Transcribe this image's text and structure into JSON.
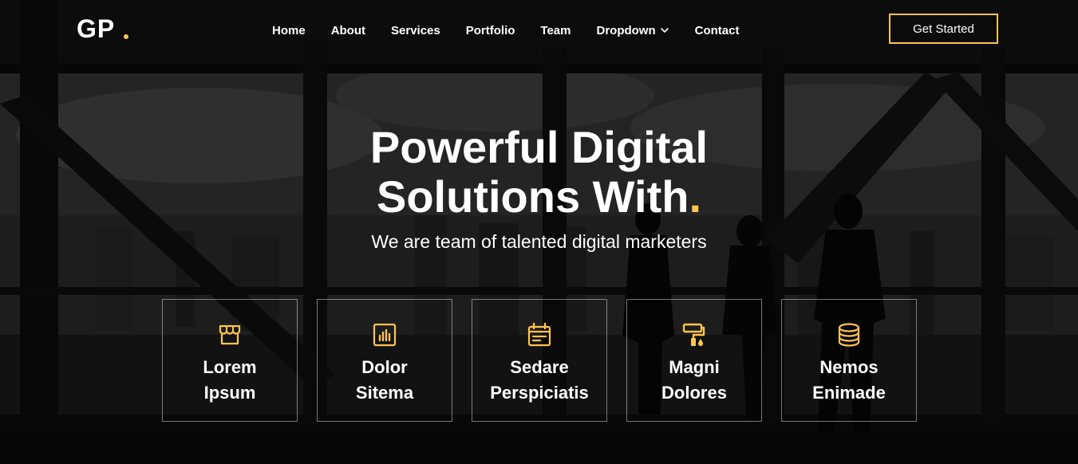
{
  "header": {
    "logo": "GP",
    "nav": [
      {
        "label": "Home"
      },
      {
        "label": "About"
      },
      {
        "label": "Services"
      },
      {
        "label": "Portfolio"
      },
      {
        "label": "Team"
      },
      {
        "label": "Dropdown"
      },
      {
        "label": "Contact"
      }
    ],
    "cta_label": "Get Started"
  },
  "hero": {
    "title_line1": "Powerful Digital",
    "title_line2": "Solutions With",
    "title_accent": ".",
    "subtitle": "We are team of talented digital marketers"
  },
  "icon_boxes": [
    {
      "icon": "store-icon",
      "line1": "Lorem",
      "line2": "Ipsum"
    },
    {
      "icon": "bar-chart-icon",
      "line1": "Dolor",
      "line2": "Sitema"
    },
    {
      "icon": "calendar-icon",
      "line1": "Sedare",
      "line2": "Perspiciatis"
    },
    {
      "icon": "paint-roller-icon",
      "line1": "Magni",
      "line2": "Dolores"
    },
    {
      "icon": "database-icon",
      "line1": "Nemos",
      "line2": "Enimade"
    }
  ],
  "colors": {
    "accent": "#ffc451",
    "text": "#ffffff",
    "box_border": "rgba(255,255,255,0.45)"
  }
}
